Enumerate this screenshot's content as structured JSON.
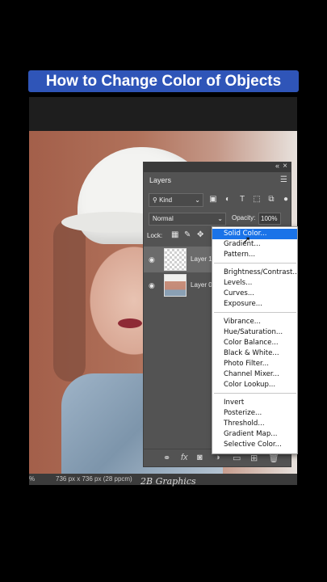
{
  "title_banner": "How to Change Color of Objects",
  "status_bar": {
    "zoom": "%",
    "doc_info": "736 px x 736 px (28 ppcm)"
  },
  "watermark": "2B Graphics",
  "layers_panel": {
    "tab": "Layers",
    "filter_kind": "Kind",
    "blend_mode": "Normal",
    "opacity_label": "Opacity:",
    "opacity_value": "100%",
    "lock_label": "Lock:",
    "layers": [
      {
        "name": "Layer 1"
      },
      {
        "name": "Layer 0"
      }
    ]
  },
  "adjustment_menu": {
    "groups": [
      [
        "Solid Color...",
        "Gradient...",
        "Pattern..."
      ],
      [
        "Brightness/Contrast...",
        "Levels...",
        "Curves...",
        "Exposure..."
      ],
      [
        "Vibrance...",
        "Hue/Saturation...",
        "Color Balance...",
        "Black & White...",
        "Photo Filter...",
        "Channel Mixer...",
        "Color Lookup..."
      ],
      [
        "Invert",
        "Posterize...",
        "Threshold...",
        "Gradient Map...",
        "Selective Color..."
      ]
    ],
    "highlighted": "Solid Color..."
  },
  "colors": {
    "banner": "#2f55b8",
    "panel": "#535353",
    "menu_highlight": "#1a73e8"
  }
}
